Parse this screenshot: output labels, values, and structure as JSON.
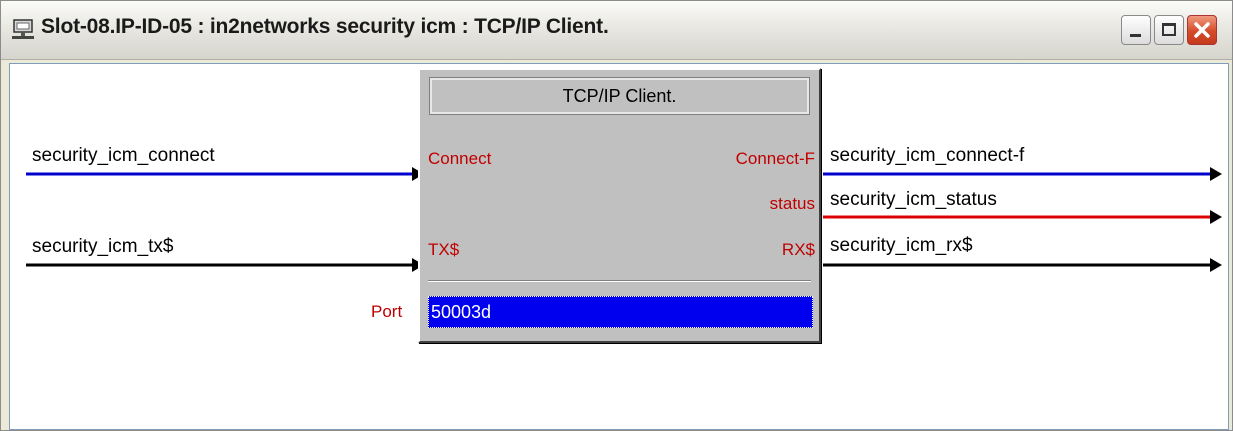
{
  "window": {
    "title": "Slot-08.IP-ID-05 : in2networks security icm : TCP/IP Client."
  },
  "block": {
    "title": "TCP/IP Client.",
    "inputs": {
      "connect": "Connect",
      "tx": "TX$"
    },
    "outputs": {
      "connect_f": "Connect-F",
      "status": "status",
      "rx": "RX$"
    },
    "param_label": "Port",
    "param_value": "50003d"
  },
  "signals": {
    "in_connect": "security_icm_connect",
    "in_tx": "security_icm_tx$",
    "out_connect_f": "security_icm_connect-f",
    "out_status": "security_icm_status",
    "out_rx": "security_icm_rx$"
  },
  "colors": {
    "wire_digital": "#0000cc",
    "wire_analog": "#dd0000",
    "wire_serial": "#000000",
    "port_label": "#c00000",
    "param_field_bg": "#0000ee"
  },
  "icons": {
    "window": "network-computer-icon",
    "minimize": "minimize-icon",
    "maximize": "maximize-icon",
    "close": "close-icon"
  }
}
